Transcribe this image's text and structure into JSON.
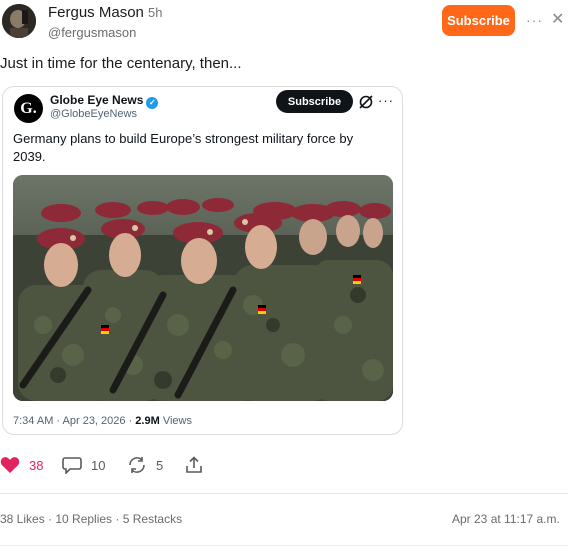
{
  "post": {
    "author_name": "Fergus Mason",
    "time_ago": "5h",
    "author_handle": "@fergusmason",
    "subscribe_label": "Subscribe",
    "text": "Just in time for the centenary, then..."
  },
  "embed": {
    "logo_text": "G.",
    "name": "Globe Eye News",
    "handle": "@GlobeEyeNews",
    "subscribe_label": "Subscribe",
    "text": "Germany plans to build Europe’s strongest military force by 2039.",
    "date": "7:34 AM · Apr 23, 2026 · ",
    "views_count": "2.9M",
    "views_label": " Views",
    "image_icon": "soldiers-photo"
  },
  "actions": {
    "likes": "38",
    "comments": "10",
    "restacks": "5"
  },
  "footer": {
    "stats": "38 Likes · 10 Replies · 5 Restacks",
    "timestamp": "Apr 23 at 11:17 a.m."
  },
  "colors": {
    "subscribe": "#ff6719",
    "like": "#e0245e",
    "verified": "#1d9bf0"
  }
}
